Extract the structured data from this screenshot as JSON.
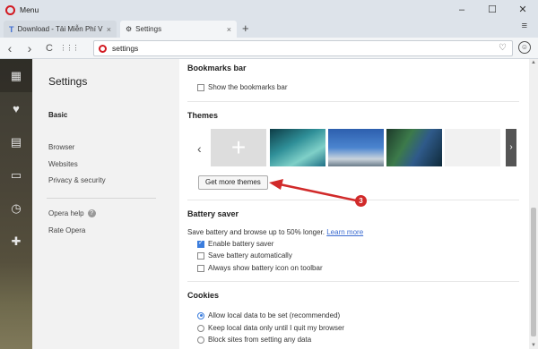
{
  "window": {
    "menu_label": "Menu",
    "minimize": "–",
    "maximize": "☐",
    "close": "✕"
  },
  "tabs": [
    {
      "favicon": "T",
      "label": "Download - Tải Miễn Phí V",
      "close": "×"
    },
    {
      "favicon": "gear-icon",
      "label": "Settings",
      "close": "×"
    }
  ],
  "new_tab": "+",
  "tab_menu": "≡",
  "address": {
    "value": "settings",
    "back": "‹",
    "forward": "›",
    "reload": "C",
    "speed_dial": "⋮⋮⋮",
    "bookmark": "♡",
    "account": "☺"
  },
  "sidebar_icons": [
    "speed-dial-icon",
    "heart-icon",
    "news-icon",
    "devices-icon",
    "history-icon",
    "extensions-icon"
  ],
  "leftnav": {
    "title": "Settings",
    "items": [
      "Basic",
      "Browser",
      "Websites",
      "Privacy & security"
    ],
    "extras": [
      "Opera help",
      "Rate Opera"
    ],
    "help_icon": "?"
  },
  "bookmarks": {
    "heading": "Bookmarks bar",
    "show_label": "Show the bookmarks bar",
    "show_checked": false
  },
  "themes": {
    "heading": "Themes",
    "prev": "‹",
    "next": "›",
    "add": "+",
    "get_more": "Get more themes"
  },
  "annotation": {
    "number": "3",
    "color": "#d12a2a"
  },
  "battery": {
    "heading": "Battery saver",
    "description": "Save battery and browse up to 50% longer.",
    "learn_more": "Learn more",
    "options": [
      {
        "label": "Enable battery saver",
        "checked": true
      },
      {
        "label": "Save battery automatically",
        "checked": false
      },
      {
        "label": "Always show battery icon on toolbar",
        "checked": false
      }
    ]
  },
  "cookies": {
    "heading": "Cookies",
    "options": [
      {
        "label": "Allow local data to be set (recommended)",
        "selected": true
      },
      {
        "label": "Keep local data only until I quit my browser",
        "selected": false
      },
      {
        "label": "Block sites from setting any data",
        "selected": false
      }
    ]
  },
  "colors": {
    "opera_red": "#d21921",
    "accent": "#3b7ddd",
    "link": "#3b6bd0"
  }
}
